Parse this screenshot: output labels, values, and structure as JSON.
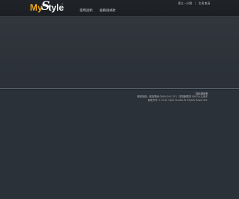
{
  "brand": {
    "my": "My",
    "s": "S",
    "tyle": "tyle",
    "tm": "™"
  },
  "nav": {
    "items": [
      {
        "label": "使用說明"
      },
      {
        "label": "服務與條款"
      }
    ]
  },
  "top_links": {
    "first": "建立一分類",
    "second": "註冊會員",
    "separator": "|"
  },
  "footer": {
    "privacy": "隱私權政策",
    "line1": "服務信箱：客服專線 0800-000-123｜瀏覽器需求 IE8.0以上版本",
    "line2": "版權所有 © 2011 Style Studio All Rights Reserved."
  },
  "colors": {
    "background": "#2b3138",
    "header": "#1d2125",
    "accent": "#e6a31c"
  }
}
